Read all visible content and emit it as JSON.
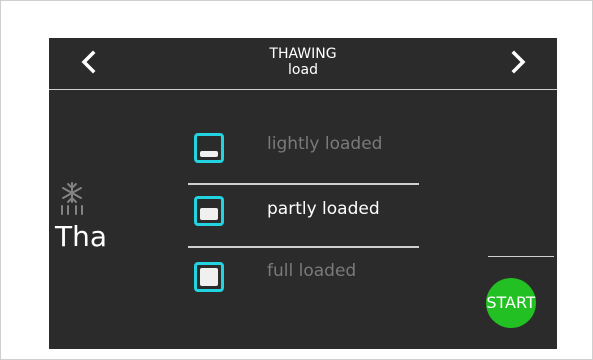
{
  "header": {
    "title": "THAWING",
    "subtitle": "load",
    "prev_icon": "chevron-left-icon",
    "next_icon": "chevron-right-icon"
  },
  "mode": {
    "icon": "thaw-snowflake-icon",
    "label": "Tha"
  },
  "options": [
    {
      "label": "lightly loaded",
      "fill_level": 0.3,
      "selected": false
    },
    {
      "label": "partly loaded",
      "fill_level": 0.6,
      "selected": true
    },
    {
      "label": "full loaded",
      "fill_level": 1.0,
      "selected": false
    }
  ],
  "start_button": {
    "label": "START",
    "color": "#22c022"
  },
  "colors": {
    "screen_bg": "#2b2b2b",
    "accent": "#22d3e0",
    "active_text": "#ffffff",
    "dim_text": "#7a7a7a"
  }
}
